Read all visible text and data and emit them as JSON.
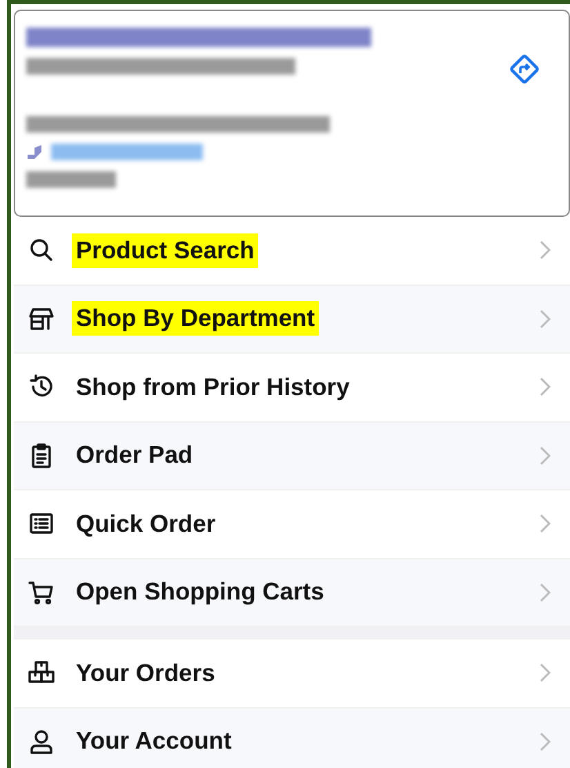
{
  "store_card": {
    "lines": [
      {
        "kind": "title"
      },
      {
        "kind": "text"
      },
      {
        "kind": "gap"
      },
      {
        "kind": "text"
      },
      {
        "kind": "phone"
      },
      {
        "kind": "text"
      }
    ]
  },
  "menu_sections": [
    {
      "items": [
        {
          "label": "Product Search",
          "kind": "search",
          "highlighted": true
        },
        {
          "label": "Shop By Department",
          "kind": "store",
          "highlighted": true
        },
        {
          "label": "Shop from Prior History",
          "kind": "history",
          "highlighted": false
        },
        {
          "label": "Order Pad",
          "kind": "clipboard",
          "highlighted": false
        },
        {
          "label": "Quick Order",
          "kind": "list",
          "highlighted": false
        },
        {
          "label": "Open Shopping Carts",
          "kind": "cart",
          "highlighted": false
        }
      ]
    },
    {
      "items": [
        {
          "label": "Your Orders",
          "kind": "boxes",
          "highlighted": false
        },
        {
          "label": "Your Account",
          "kind": "person",
          "highlighted": false
        }
      ]
    }
  ]
}
